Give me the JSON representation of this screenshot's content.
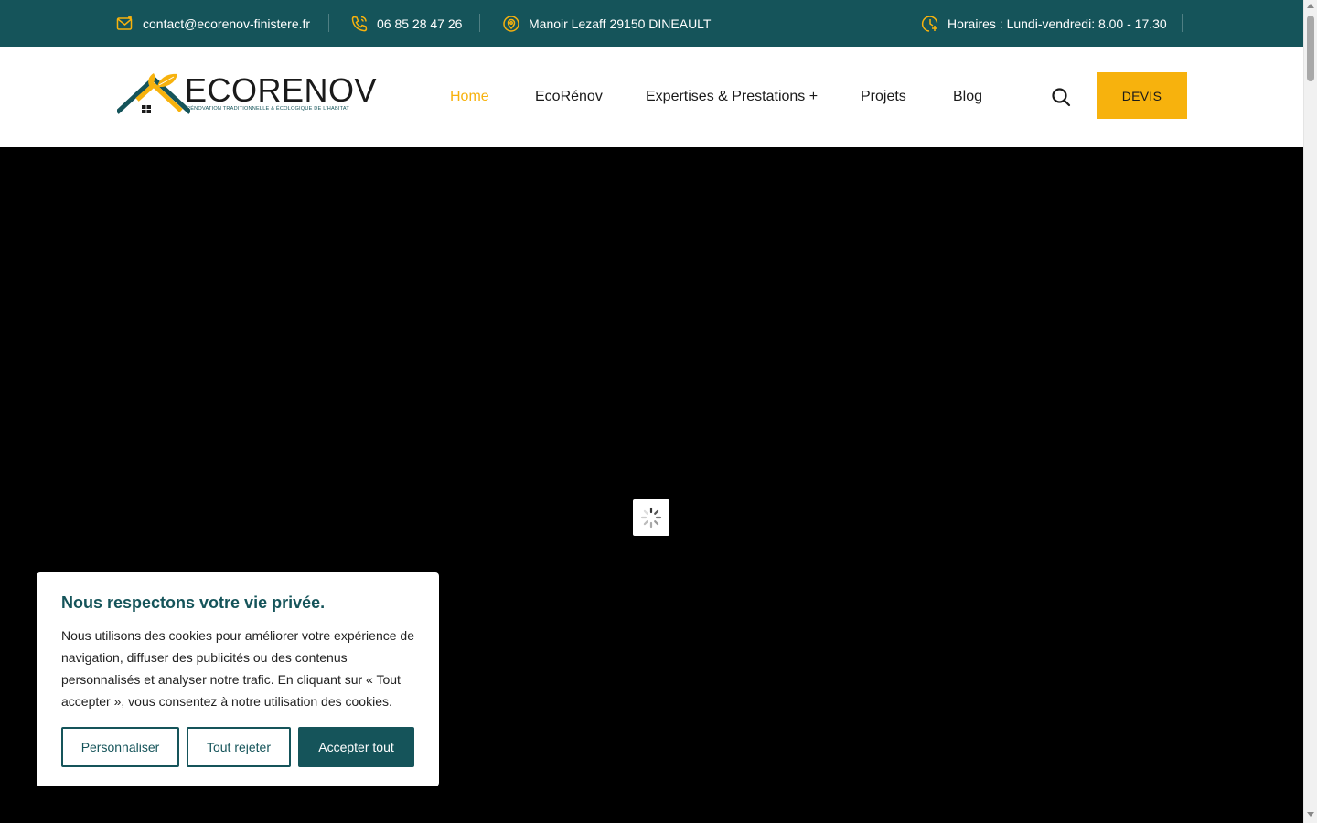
{
  "colors": {
    "accent": "#f7b20d",
    "brand": "#15545a",
    "hero_bg": "#000000"
  },
  "topbar": {
    "email": {
      "icon": "mail-icon",
      "text": "contact@ecorenov-finistere.fr"
    },
    "phone": {
      "icon": "phone-icon",
      "text": "06 85 28 47 26"
    },
    "address": {
      "icon": "location-icon",
      "text": "Manoir Lezaff 29150 DINEAULT"
    },
    "hours": {
      "icon": "clock-icon",
      "text": "Horaires : Lundi-vendredi: 8.00 - 17.30"
    }
  },
  "logo": {
    "word": "ECORENOV",
    "tagline": "RÉNOVATION TRADITIONNELLE & ÉCOLOGIQUE DE L'HABITAT"
  },
  "nav": {
    "items": [
      {
        "label": "Home",
        "active": true
      },
      {
        "label": "EcoRénov"
      },
      {
        "label": "Expertises & Prestations +"
      },
      {
        "label": "Projets"
      },
      {
        "label": "Blog"
      }
    ],
    "search_icon": "search-icon",
    "devis_label": "DEVIS"
  },
  "hero": {
    "state": "loading",
    "spinner_icon": "spinner-icon"
  },
  "cookie": {
    "title": "Nous respectons votre vie privée.",
    "body": "Nous utilisons des cookies pour améliorer votre expérience de navigation, diffuser des publicités ou des contenus personnalisés et analyser notre trafic. En cliquant sur « Tout accepter », vous consentez à notre utilisation des cookies.",
    "buttons": {
      "customize": "Personnaliser",
      "reject": "Tout rejeter",
      "accept": "Accepter tout"
    }
  }
}
